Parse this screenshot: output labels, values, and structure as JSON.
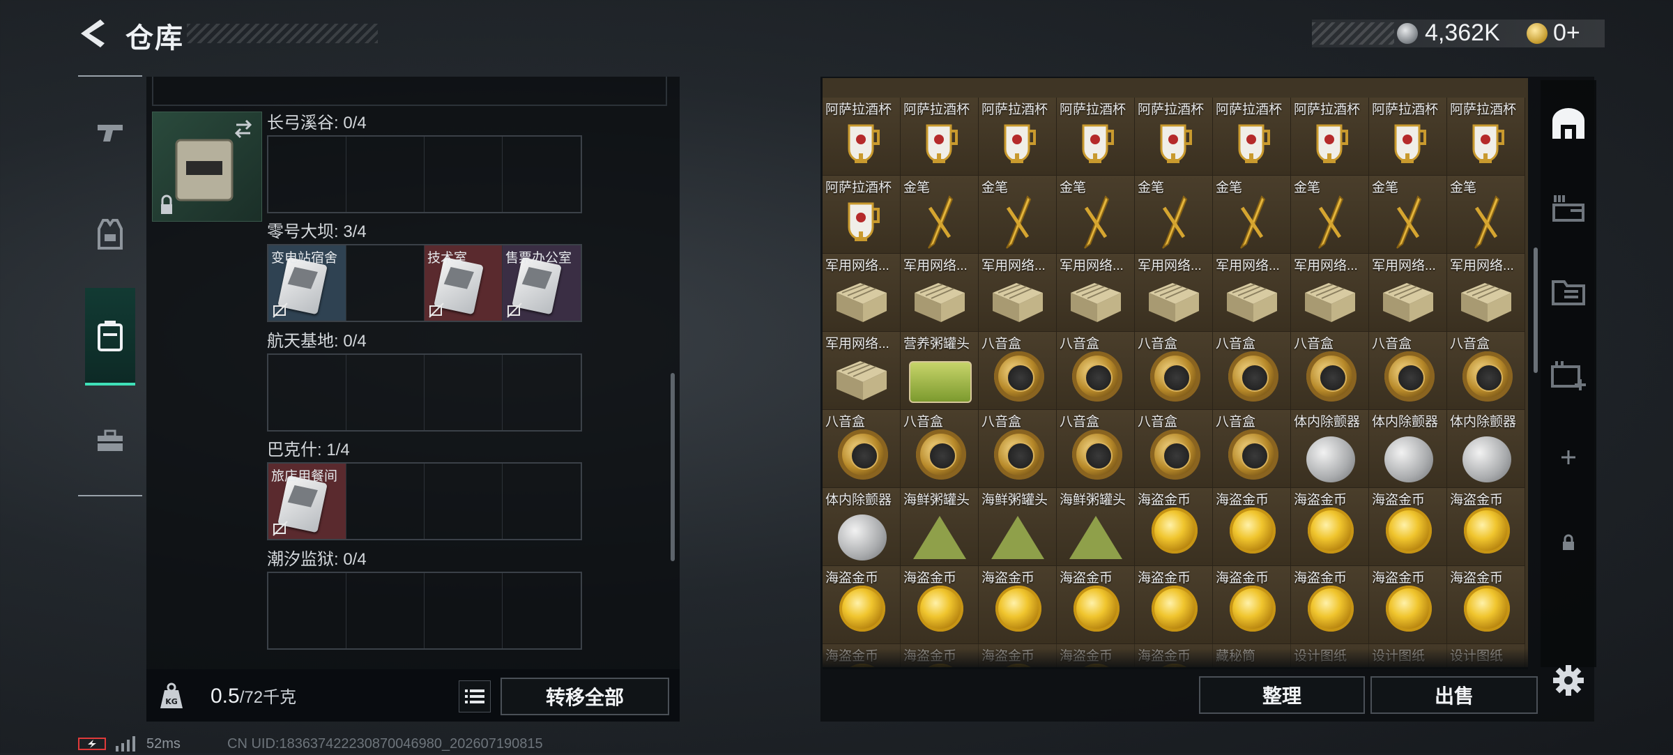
{
  "header": {
    "title": "仓库",
    "currency_1": "4,362K",
    "currency_2": "0+"
  },
  "sidebar": {
    "tabs": [
      {
        "name": "weapons",
        "icon": "pistol-icon"
      },
      {
        "name": "equipment",
        "icon": "vest-icon"
      },
      {
        "name": "keycards",
        "icon": "keycard-case-icon",
        "active": true
      },
      {
        "name": "toolbox",
        "icon": "toolbox-icon"
      }
    ]
  },
  "left": {
    "maps": [
      {
        "label": "长弓溪谷: 0/4",
        "slots": [
          "",
          "",
          "",
          ""
        ]
      },
      {
        "label": "零号大坝: 3/4",
        "slots": [
          "变电站宿舍",
          "",
          "技术室",
          "售票办公室"
        ]
      },
      {
        "label": "航天基地: 0/4",
        "slots": [
          "",
          "",
          "",
          ""
        ]
      },
      {
        "label": "巴克什: 1/4",
        "slots": [
          "旅店用餐间",
          "",
          "",
          ""
        ]
      },
      {
        "label": "潮汐监狱: 0/4",
        "slots": [
          "",
          "",
          "",
          ""
        ]
      }
    ],
    "weight_value": "0.5",
    "weight_max": "/72千克",
    "transfer_all": "转移全部"
  },
  "right": {
    "rows": [
      [
        "阿萨拉酒杯",
        "阿萨拉酒杯",
        "阿萨拉酒杯",
        "阿萨拉酒杯",
        "阿萨拉酒杯",
        "阿萨拉酒杯",
        "阿萨拉酒杯",
        "阿萨拉酒杯",
        "阿萨拉酒杯"
      ],
      [
        "阿萨拉酒杯",
        "金笔",
        "金笔",
        "金笔",
        "金笔",
        "金笔",
        "金笔",
        "金笔",
        "金笔"
      ],
      [
        "军用网络...",
        "军用网络...",
        "军用网络...",
        "军用网络...",
        "军用网络...",
        "军用网络...",
        "军用网络...",
        "军用网络...",
        "军用网络..."
      ],
      [
        "军用网络...",
        "营养粥罐头",
        "八音盒",
        "八音盒",
        "八音盒",
        "八音盒",
        "八音盒",
        "八音盒",
        "八音盒"
      ],
      [
        "八音盒",
        "八音盒",
        "八音盒",
        "八音盒",
        "八音盒",
        "八音盒",
        "体内除颤器",
        "体内除颤器",
        "体内除颤器"
      ],
      [
        "体内除颤器",
        "海鲜粥罐头",
        "海鲜粥罐头",
        "海鲜粥罐头",
        "海盗金币",
        "海盗金币",
        "海盗金币",
        "海盗金币",
        "海盗金币"
      ],
      [
        "海盗金币",
        "海盗金币",
        "海盗金币",
        "海盗金币",
        "海盗金币",
        "海盗金币",
        "海盗金币",
        "海盗金币",
        "海盗金币"
      ],
      [
        "海盗金币",
        "海盗金币",
        "海盗金币",
        "海盗金币",
        "海盗金币",
        "藏秘筒",
        "设计图纸",
        "设计图纸",
        "设计图纸"
      ]
    ],
    "sort": "整理",
    "sell": "出售"
  },
  "status": {
    "ping": "52ms",
    "uid": "CN UID:18363742223087004698​0_202607190815"
  },
  "colors": {
    "accent": "#3fe0b8",
    "panel": "#0a0d10",
    "item_bg": "#3f3525"
  }
}
